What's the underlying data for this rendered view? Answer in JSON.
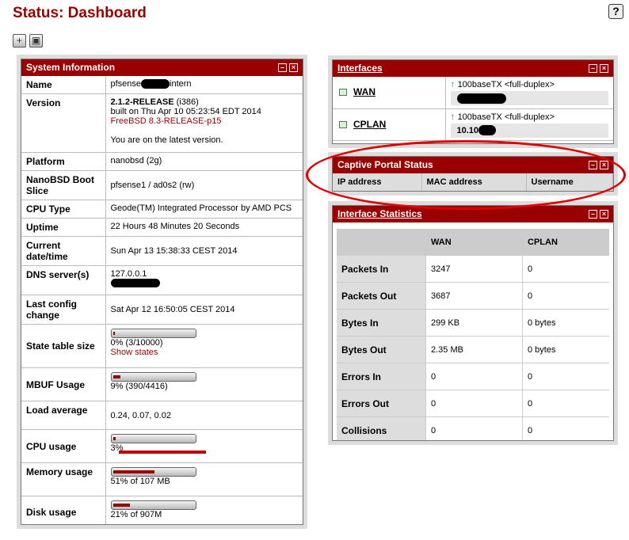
{
  "header": {
    "title": "Status: Dashboard",
    "help_label": "?"
  },
  "system_information": {
    "title": "System Information",
    "rows": {
      "name": {
        "label": "Name",
        "prefix": "pfsense",
        "suffix": "intern"
      },
      "version": {
        "label": "Version",
        "release": "2.1.2-RELEASE",
        "arch": " (i386)",
        "built": "built on Thu Apr 10 05:23:54 EDT 2014",
        "freebsd": "FreeBSD 8.3-RELEASE-p15",
        "update": "You are on the latest version."
      },
      "platform": {
        "label": "Platform",
        "value": "nanobsd (2g)"
      },
      "boot_slice": {
        "label": "NanoBSD Boot Slice",
        "value": "pfsense1 / ad0s2 (rw)"
      },
      "cpu_type": {
        "label": "CPU Type",
        "value": "Geode(TM) Integrated Processor by AMD PCS"
      },
      "uptime": {
        "label": "Uptime",
        "value": "22 Hours 48 Minutes 20 Seconds"
      },
      "current_date": {
        "label": "Current date/time",
        "value": "Sun Apr 13 15:38:33 CEST 2014"
      },
      "dns": {
        "label": "DNS server(s)",
        "value": "127.0.0.1"
      },
      "last_config": {
        "label": "Last config change",
        "value": "Sat Apr 12 16:50:05 CEST 2014"
      },
      "state_table": {
        "label": "State table size",
        "value": "0% (3/10000)",
        "link": "Show states",
        "percent": 0
      },
      "mbuf": {
        "label": "MBUF Usage",
        "value": "9% (390/4416)",
        "percent": 9
      },
      "load": {
        "label": "Load average",
        "value": "0.24, 0.07, 0.02"
      },
      "cpu_usage": {
        "label": "CPU usage",
        "value": "3%",
        "percent": 3
      },
      "memory": {
        "label": "Memory usage",
        "value": "51% of 107 MB",
        "percent": 51
      },
      "disk": {
        "label": "Disk usage",
        "value": "21% of 907M",
        "percent": 21
      }
    }
  },
  "interfaces": {
    "title": "Interfaces",
    "items": [
      {
        "name": "WAN",
        "media": "100baseTX <full-duplex>",
        "ip": ""
      },
      {
        "name": "CPLAN",
        "media": "100baseTX <full-duplex>",
        "ip": "10.10"
      }
    ]
  },
  "captive_portal": {
    "title": "Captive Portal Status",
    "columns": [
      "IP address",
      "MAC address",
      "Username"
    ]
  },
  "interface_statistics": {
    "title": "Interface Statistics",
    "columns": [
      "WAN",
      "CPLAN"
    ],
    "rows": [
      {
        "label": "Packets In",
        "wan": "3247",
        "cplan": "0"
      },
      {
        "label": "Packets Out",
        "wan": "3687",
        "cplan": "0"
      },
      {
        "label": "Bytes In",
        "wan": "299 KB",
        "cplan": "0 bytes"
      },
      {
        "label": "Bytes Out",
        "wan": "2.35 MB",
        "cplan": "0 bytes"
      },
      {
        "label": "Errors In",
        "wan": "0",
        "cplan": "0"
      },
      {
        "label": "Errors Out",
        "wan": "0",
        "cplan": "0"
      },
      {
        "label": "Collisions",
        "wan": "0",
        "cplan": "0"
      }
    ]
  },
  "colors": {
    "accent": "#990000",
    "panel_bg": "#dddddd",
    "annotation": "#e00000"
  }
}
